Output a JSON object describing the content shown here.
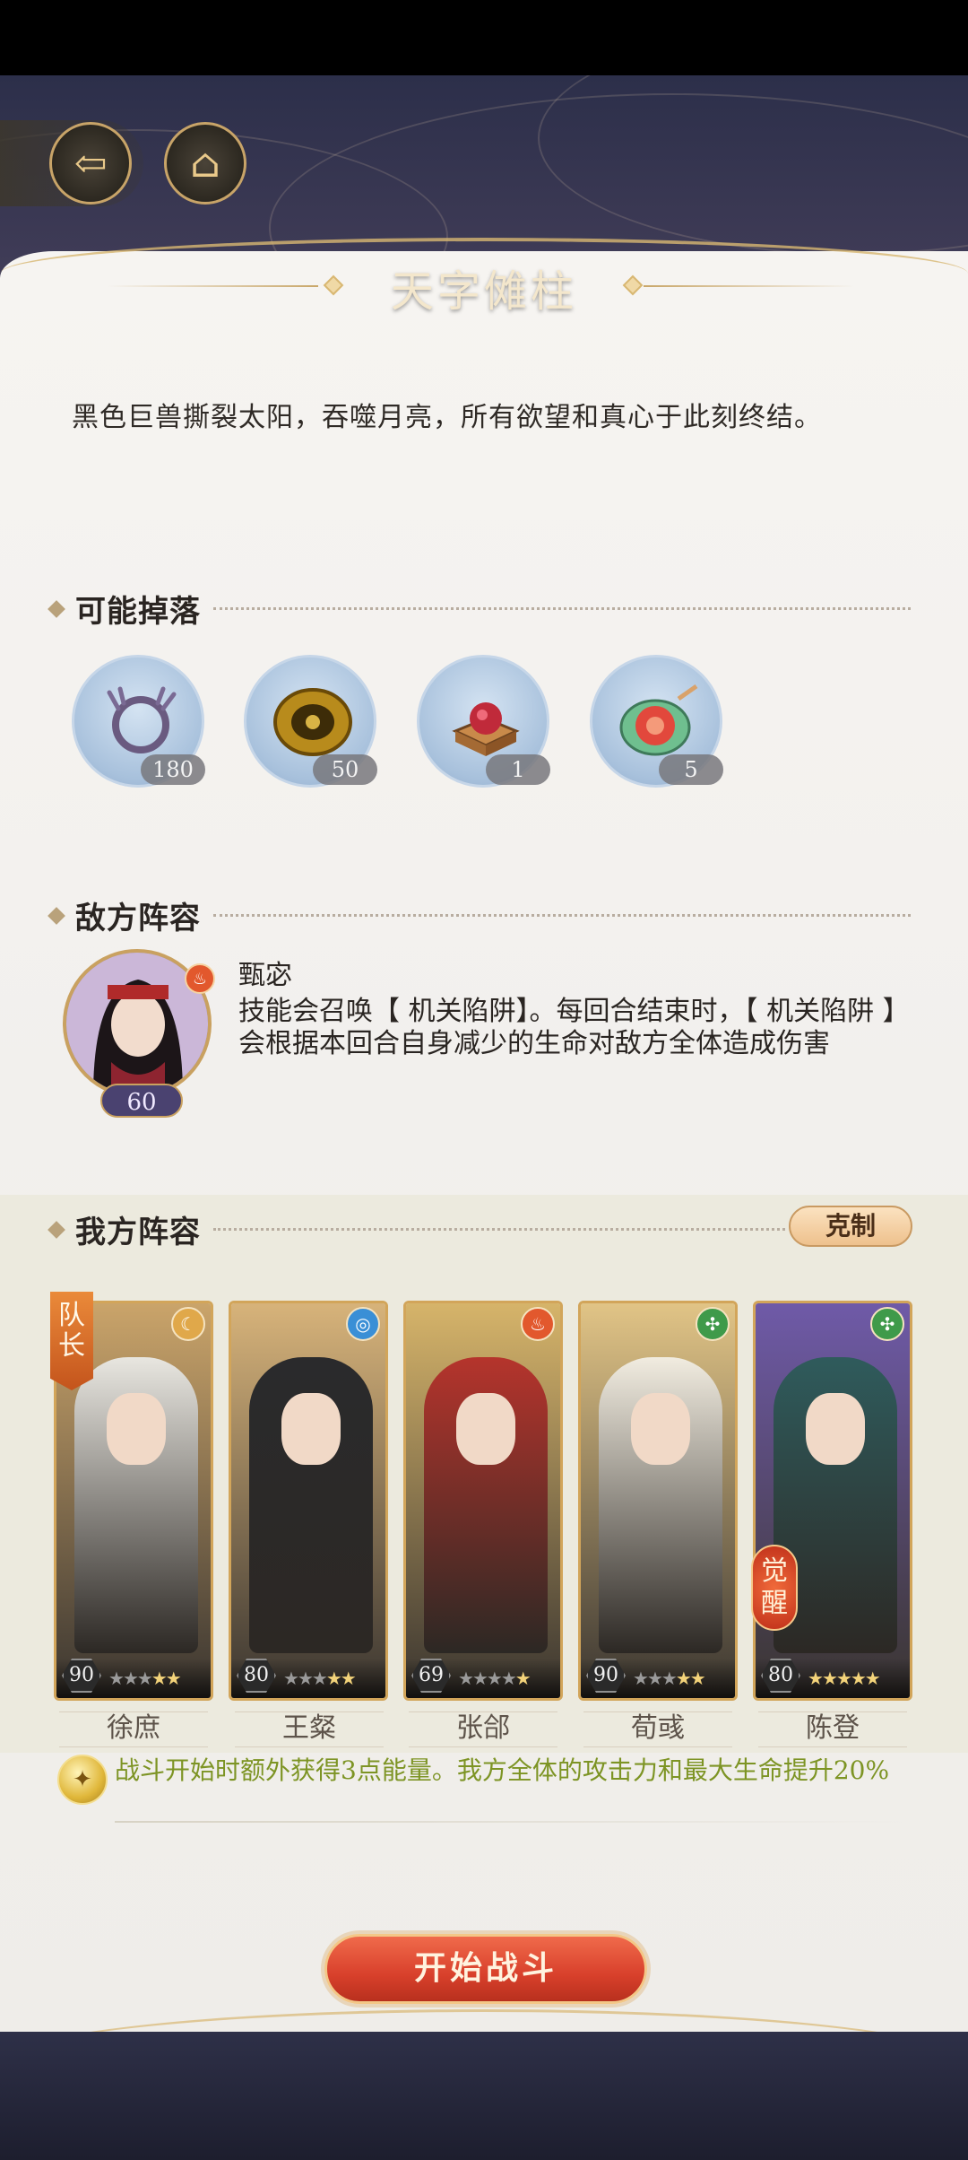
{
  "header": {
    "title": "天字傩柱"
  },
  "description": "黑色巨兽撕裂太阳，吞噬月亮，所有欲望和真心于此刻终结。",
  "drops": {
    "heading": "可能掉落",
    "items": [
      {
        "icon": "antler-wreath-icon",
        "qty": "180"
      },
      {
        "icon": "bronze-disc-icon",
        "qty": "50"
      },
      {
        "icon": "jewel-box-icon",
        "qty": "1"
      },
      {
        "icon": "lotus-plate-icon",
        "qty": "5"
      }
    ]
  },
  "enemy": {
    "heading": "敌方阵容",
    "name": "甄宓",
    "level": "60",
    "element": "fire",
    "skill": "技能会召唤【 机关陷阱】。每回合结束时，【 机关陷阱 】会根据本回合自身减少的生命对敌方全体造成伤害"
  },
  "team": {
    "heading": "我方阵容",
    "counter_label": "克制",
    "captain_label": "队长",
    "awaken_label": "觉醒",
    "heroes": [
      {
        "name": "徐庶",
        "level": "90",
        "stars": 5,
        "filled": 2,
        "element": "moon",
        "bg": "#caa46a",
        "robe": "#e8e6e0"
      },
      {
        "name": "王粲",
        "level": "80",
        "stars": 5,
        "filled": 2,
        "element": "water",
        "bg": "#d7b37a",
        "robe": "#2a2a2c"
      },
      {
        "name": "张郃",
        "level": "69",
        "stars": 5,
        "filled": 1,
        "element": "fire",
        "bg": "#d6b46a",
        "robe": "#b5342c"
      },
      {
        "name": "荀彧",
        "level": "90",
        "stars": 5,
        "filled": 2,
        "element": "wind",
        "bg": "#e1c486",
        "robe": "#f1ece0"
      },
      {
        "name": "陈登",
        "level": "80",
        "stars": 5,
        "filled": 5,
        "element": "wind",
        "bg": "#6f5aa8",
        "robe": "#2f5b5c"
      }
    ]
  },
  "bonus": {
    "text": "战斗开始时额外获得3点能量。我方全体的攻击力和最大生命提升20%"
  },
  "start_button": "开始战斗",
  "colors": {
    "accent_gold": "#d8b772",
    "start_red": "#d8402b",
    "bonus_green": "#7d9424"
  }
}
